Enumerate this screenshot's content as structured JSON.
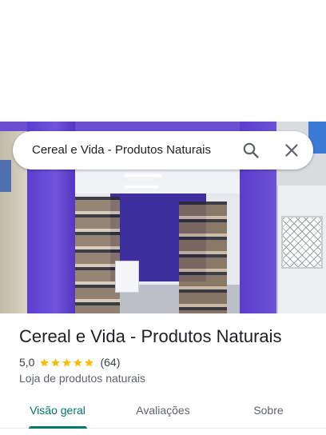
{
  "search": {
    "query": "Cereal e Vida - Produtos Naturais",
    "search_icon": "search-icon",
    "close_icon": "close-icon"
  },
  "place": {
    "title": "Cereal e Vida - Produtos Naturais",
    "rating": "5,0",
    "stars": 5,
    "review_count": "(64)",
    "category": "Loja de produtos naturais"
  },
  "tabs": [
    {
      "label": "Visão geral",
      "active": true
    },
    {
      "label": "Avaliações",
      "active": false
    },
    {
      "label": "Sobre",
      "active": false
    }
  ],
  "colors": {
    "accent": "#00796b",
    "star": "#fbbc04",
    "facade": "#6a4fd0"
  }
}
